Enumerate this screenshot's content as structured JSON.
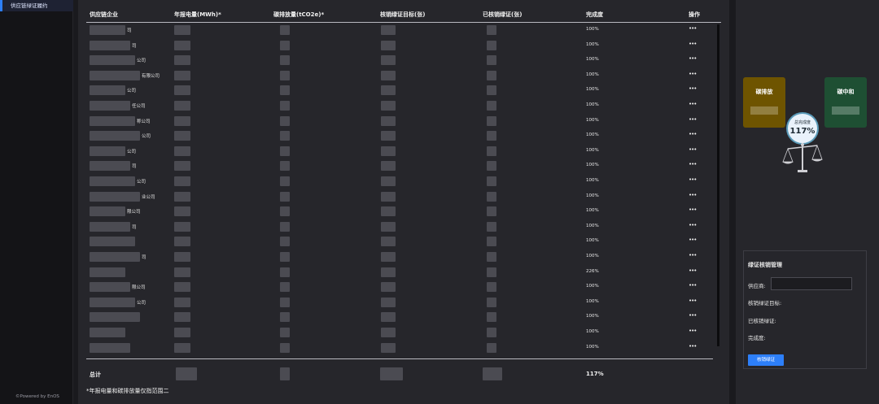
{
  "sidebar": {
    "items": [
      {
        "label": "供应链绿证履约"
      }
    ],
    "footer": "©Powered by EnOS"
  },
  "table": {
    "headers": [
      "供应链企业",
      "年报电量(MWh)*",
      "碳排放量(tCO2e)*",
      "核销绿证目标(张)",
      "已核销绿证(张)",
      "完成度",
      "操作"
    ],
    "rows": [
      {
        "company_suffix": "司",
        "completion": "100%",
        "action": "•••"
      },
      {
        "company_suffix": "司",
        "completion": "100%",
        "action": "•••"
      },
      {
        "company_suffix": "公司",
        "completion": "100%",
        "action": "•••"
      },
      {
        "company_suffix": "有限公司",
        "completion": "100%",
        "action": "•••"
      },
      {
        "company_suffix": "公司",
        "completion": "100%",
        "action": "•••"
      },
      {
        "company_suffix": "任公司",
        "completion": "100%",
        "action": "•••"
      },
      {
        "company_suffix": "称公司",
        "completion": "100%",
        "action": "•••"
      },
      {
        "company_suffix": "公司",
        "completion": "100%",
        "action": "•••"
      },
      {
        "company_suffix": "公司",
        "completion": "100%",
        "action": "•••"
      },
      {
        "company_suffix": "司",
        "completion": "100%",
        "action": "•••"
      },
      {
        "company_suffix": "公司",
        "completion": "100%",
        "action": "•••"
      },
      {
        "company_suffix": "业公司",
        "completion": "100%",
        "action": "•••"
      },
      {
        "company_suffix": "限公司",
        "completion": "100%",
        "action": "•••"
      },
      {
        "company_suffix": "司",
        "completion": "100%",
        "action": "•••"
      },
      {
        "company_suffix": "",
        "completion": "100%",
        "action": "•••"
      },
      {
        "company_suffix": "司",
        "completion": "100%",
        "action": "•••"
      },
      {
        "company_suffix": "",
        "completion": "226%",
        "action": "•••"
      },
      {
        "company_suffix": "限公司",
        "completion": "100%",
        "action": "•••"
      },
      {
        "company_suffix": "公司",
        "completion": "100%",
        "action": "•••"
      },
      {
        "company_suffix": "",
        "completion": "100%",
        "action": "•••"
      },
      {
        "company_suffix": "",
        "completion": "100%",
        "action": "•••"
      },
      {
        "company_suffix": "",
        "completion": "100%",
        "action": "•••"
      }
    ],
    "total_label": "总计",
    "total_completion": "117%",
    "footnote": "*年报电量和碳排放量仅指范围二"
  },
  "scale": {
    "left_label": "碳排放",
    "right_label": "碳中和",
    "bubble_label": "总完成度",
    "bubble_value": "117%",
    "colors": {
      "emission": "#6e5400",
      "neutral": "#1e4f33",
      "accent": "#2d7ff9"
    }
  },
  "cert_panel": {
    "title": "绿证核销管理",
    "supplier_label": "供应商:",
    "supplier_value": "",
    "target_label": "核销绿证目标:",
    "done_label": "已核销绿证:",
    "completion_label": "完成度:",
    "button_label": "核销绿证"
  }
}
